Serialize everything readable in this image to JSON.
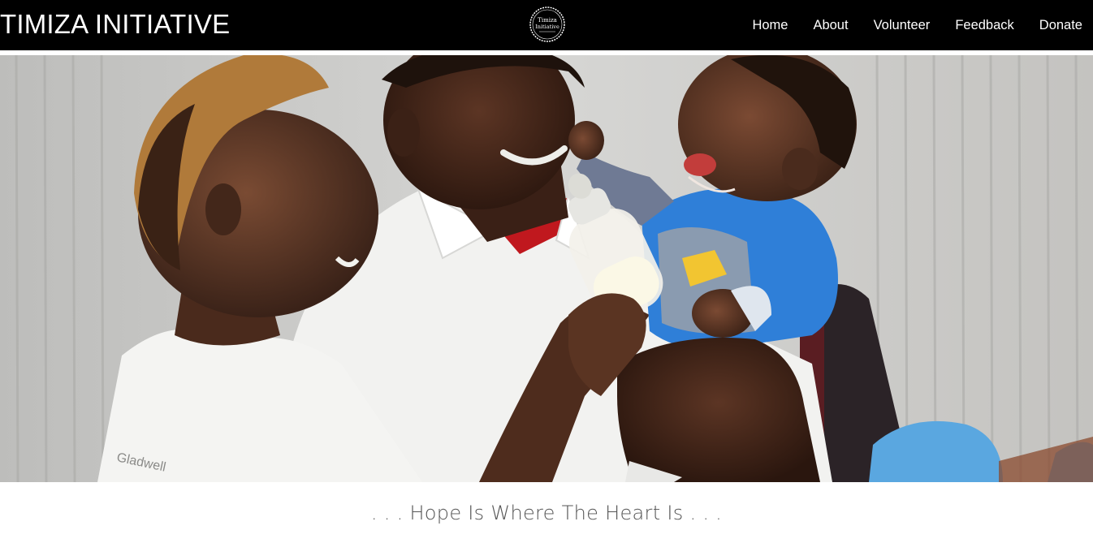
{
  "header": {
    "brand": "TIMIZA INITIATIVE",
    "logo": {
      "line1": "Timiza",
      "line2": "Initiative"
    },
    "nav": [
      {
        "label": "Home"
      },
      {
        "label": "About"
      },
      {
        "label": "Volunteer"
      },
      {
        "label": "Feedback"
      },
      {
        "label": "Donate"
      }
    ]
  },
  "hero": {
    "shirt_text": "Gladwell"
  },
  "tagline": ". . . Hope Is Where The Heart Is . . .",
  "colors": {
    "header_bg": "#000000",
    "header_text": "#ffffff",
    "tagline_text": "#555555",
    "baby_shirt": "#2f7fd8"
  }
}
